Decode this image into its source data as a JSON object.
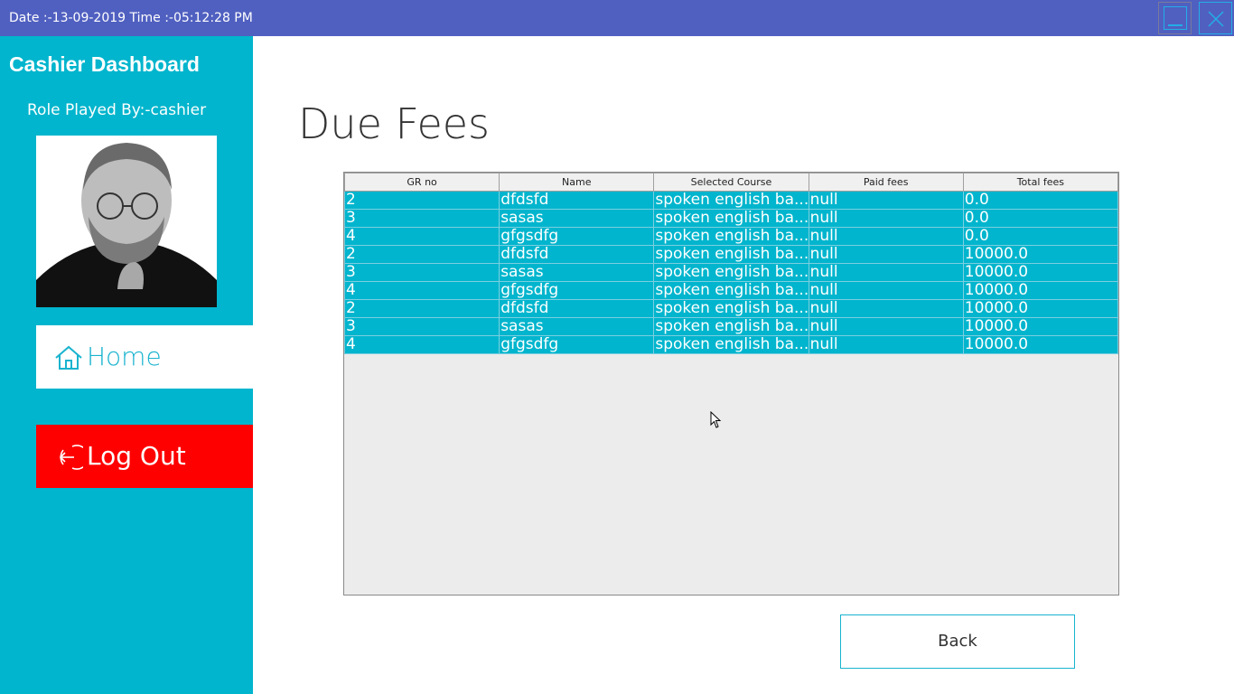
{
  "titlebar": {
    "datetime": "Date :-13-09-2019 Time :-05:12:28 PM",
    "colors": {
      "background": "#5060c0",
      "button_border": "#22aee8"
    }
  },
  "sidebar": {
    "title": "Cashier Dashboard",
    "role": "Role Played By:-cashier",
    "nav": {
      "home": "Home",
      "logout": "Log Out"
    },
    "colors": {
      "background": "#00b5cd",
      "logout": "#ff0000"
    }
  },
  "main": {
    "title": "Due Fees",
    "table": {
      "columns": [
        "GR no",
        "Name",
        "Selected Course",
        "Paid fees",
        "Total fees"
      ],
      "rows": [
        [
          "2",
          "dfdsfd",
          "spoken english ba...",
          "null",
          "0.0"
        ],
        [
          "3",
          "sasas",
          "spoken english ba...",
          "null",
          "0.0"
        ],
        [
          "4",
          "gfgsdfg",
          "spoken english ba...",
          "null",
          "0.0"
        ],
        [
          "2",
          "dfdsfd",
          "spoken english ba...",
          "null",
          "10000.0"
        ],
        [
          "3",
          "sasas",
          "spoken english ba...",
          "null",
          "10000.0"
        ],
        [
          "4",
          "gfgsdfg",
          "spoken english ba...",
          "null",
          "10000.0"
        ],
        [
          "2",
          "dfdsfd",
          "spoken english ba...",
          "null",
          "10000.0"
        ],
        [
          "3",
          "sasas",
          "spoken english ba...",
          "null",
          "10000.0"
        ],
        [
          "4",
          "gfgsdfg",
          "spoken english ba...",
          "null",
          "10000.0"
        ]
      ]
    },
    "back_label": "Back"
  },
  "icons": [
    "minimize-icon",
    "close-icon",
    "home-icon",
    "logout-icon",
    "mouse-cursor-icon"
  ]
}
